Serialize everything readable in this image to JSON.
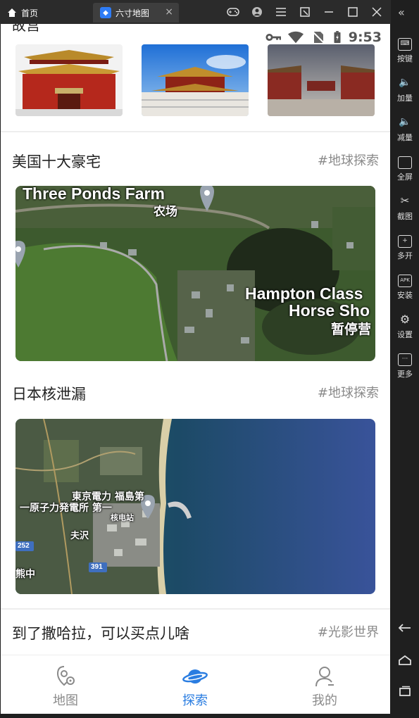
{
  "titlebar": {
    "home_tab": "首页",
    "app_tab": "六寸地图",
    "close_glyph": "×"
  },
  "statusbar": {
    "time": "9:53"
  },
  "sidebar": {
    "items": [
      {
        "label": "按键",
        "icon": "keyboard-icon"
      },
      {
        "label": "加量",
        "icon": "volume-up-icon"
      },
      {
        "label": "减量",
        "icon": "volume-down-icon"
      },
      {
        "label": "全屏",
        "icon": "fullscreen-icon"
      },
      {
        "label": "截图",
        "icon": "scissors-icon"
      },
      {
        "label": "多开",
        "icon": "multi-instance-icon"
      },
      {
        "label": "安装",
        "icon": "apk-install-icon"
      },
      {
        "label": "设置",
        "icon": "gear-icon"
      },
      {
        "label": "更多",
        "icon": "more-icon"
      }
    ]
  },
  "feed": {
    "partial_title": "故宫",
    "sections": [
      {
        "title": "美国十大豪宅",
        "tag": "#地球探索",
        "map_labels": [
          "Three Ponds Farm",
          "农场",
          "Hampton Class",
          "Horse Sho",
          "暂停营"
        ]
      },
      {
        "title": "日本核泄漏",
        "tag": "#地球探索",
        "map_labels": [
          "東京電力 福島第",
          "一原子力発電所 第一",
          "核电站",
          "夫沢",
          "252",
          "391",
          "熊中"
        ]
      },
      {
        "title": "到了撒哈拉，可以买点儿啥",
        "tag": "#光影世界"
      }
    ]
  },
  "nav": {
    "items": [
      {
        "label": "地图",
        "icon": "map-pin-icon"
      },
      {
        "label": "探索",
        "icon": "planet-icon"
      },
      {
        "label": "我的",
        "icon": "user-icon"
      }
    ]
  },
  "colors": {
    "accent": "#2a7de1",
    "tag_gray": "#8a8a8a",
    "title_black": "#222222"
  }
}
